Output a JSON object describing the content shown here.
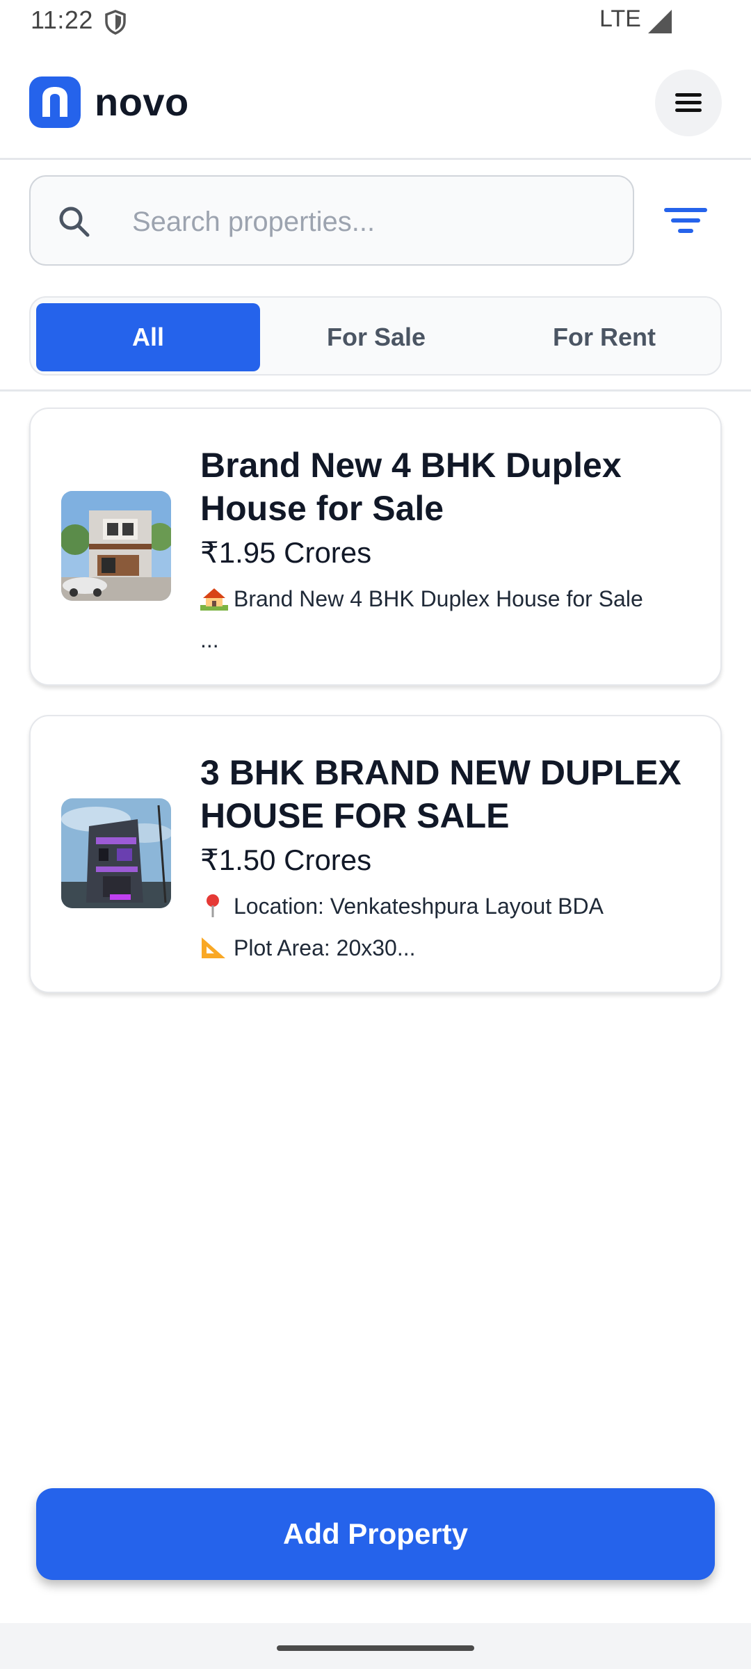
{
  "status_bar": {
    "time": "11:22",
    "network": "LTE"
  },
  "header": {
    "app_name": "novo",
    "menu_icon": "hamburger-icon"
  },
  "search": {
    "placeholder": "Search properties...",
    "value": ""
  },
  "tabs": [
    {
      "label": "All",
      "active": true
    },
    {
      "label": "For Sale",
      "active": false
    },
    {
      "label": "For Rent",
      "active": false
    }
  ],
  "listings": [
    {
      "title": "Brand New 4 BHK Duplex House for Sale",
      "price": "₹1.95 Crores",
      "line1": "Brand New 4 BHK Duplex House for Sale",
      "line1_icon": "house-emoji",
      "line2": "..."
    },
    {
      "title": "3 BHK BRAND NEW DUPLEX HOUSE FOR SALE",
      "price": "₹1.50 Crores",
      "line1": "Location: Venkateshpura Layout BDA",
      "line1_icon": "pin-emoji",
      "line2": "Plot Area: 20x30...",
      "line2_icon": "ruler-emoji"
    }
  ],
  "actions": {
    "add_label": "Add Property"
  },
  "colors": {
    "accent": "#2563eb",
    "text": "#111827",
    "muted": "#9ca3af"
  }
}
